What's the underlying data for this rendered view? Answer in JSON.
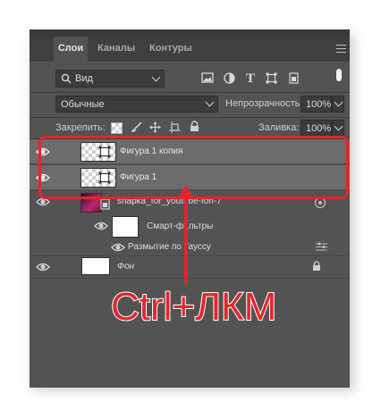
{
  "tabs": [
    "Слои",
    "Каналы",
    "Контуры"
  ],
  "filter": {
    "value": "Вид",
    "icons": [
      "image-icon",
      "adjustment-circle-icon",
      "type-icon",
      "shape-icon",
      "smart-object-icon"
    ]
  },
  "blend_mode": "Обычные",
  "opacity": {
    "label": "Непрозрачность:",
    "value": "100%"
  },
  "lock": {
    "label": "Закрепить:"
  },
  "fill": {
    "label": "Заливка:",
    "value": "100%"
  },
  "layers": [
    {
      "name": "Фигура 1 копия",
      "selected": true
    },
    {
      "name": "Фигура 1",
      "selected": true
    },
    {
      "name": "shapka_for_youtube-fon-7"
    },
    {
      "name": "Смарт-фильтры"
    },
    {
      "name": "Размытие по Гауссу"
    },
    {
      "name": "Фон"
    }
  ],
  "annotation": {
    "hotkey": "Ctrl+ЛКМ",
    "color": "#e3262b"
  }
}
